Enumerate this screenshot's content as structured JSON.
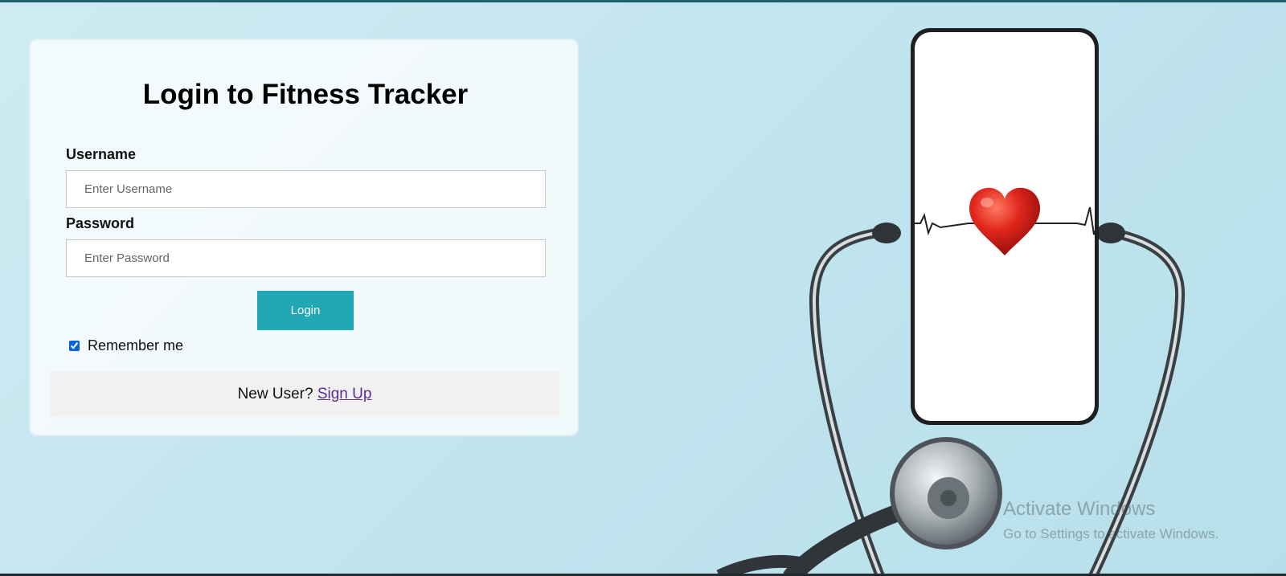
{
  "login": {
    "title": "Login to Fitness Tracker",
    "username_label": "Username",
    "username_value": "",
    "username_placeholder": "Enter Username",
    "password_label": "Password",
    "password_value": "",
    "password_placeholder": "Enter Password",
    "login_button": "Login",
    "remember_label": "Remember me",
    "remember_checked": true,
    "signup_prompt": "New User? ",
    "signup_link": "Sign Up"
  },
  "hero": {
    "icon_name": "stethoscope-phone-heart-image"
  },
  "watermark": {
    "title": "Activate Windows",
    "subtitle": "Go to Settings to activate Windows."
  },
  "colors": {
    "accent": "#22a7b5",
    "background": "#c2e5ef",
    "link_visited": "#5d2d91",
    "checkbox": "#0b63d9"
  }
}
